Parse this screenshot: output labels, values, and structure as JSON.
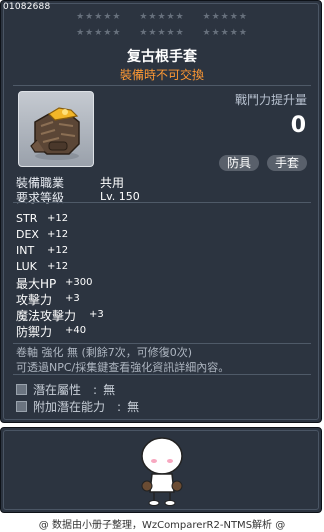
{
  "item": {
    "id": "01082688",
    "name": "复古根手套",
    "trade_note": "裝備時不可交換",
    "combat_power_label": "戰鬥力提升量",
    "combat_power_value": "0",
    "tags": [
      "防具",
      "手套"
    ]
  },
  "stars": {
    "row1": [
      "★★★★★",
      "★★★★★",
      "★★★★★"
    ],
    "row2": [
      "★★★★★",
      "★★★★★",
      "★★★★★"
    ]
  },
  "requirements": [
    {
      "label": "裝備職業",
      "value": "共用"
    },
    {
      "label": "要求等級",
      "value": "Lv. 150"
    }
  ],
  "stats": [
    {
      "name": "STR",
      "value": "+12"
    },
    {
      "name": "DEX",
      "value": "+12"
    },
    {
      "name": "INT",
      "value": "+12"
    },
    {
      "name": "LUK",
      "value": "+12"
    },
    {
      "name": "最大HP",
      "value": "+300"
    },
    {
      "name": "攻擊力",
      "value": "+3"
    },
    {
      "name": "魔法攻擊力",
      "value": "+3"
    },
    {
      "name": "防禦力",
      "value": "+40"
    }
  ],
  "scroll_info": {
    "line1": "卷軸 強化 無 (剩餘7次，可修復0次)",
    "line2": "可透過NPC/採集鍵查看強化資訊詳細內容。"
  },
  "potentials": [
    {
      "label": "潛在屬性",
      "value": "無"
    },
    {
      "label": "附加潛在能力",
      "value": "無"
    }
  ],
  "footer": "@ 数据由小册子整理，WzComparerR2-NTMS解析 @"
}
